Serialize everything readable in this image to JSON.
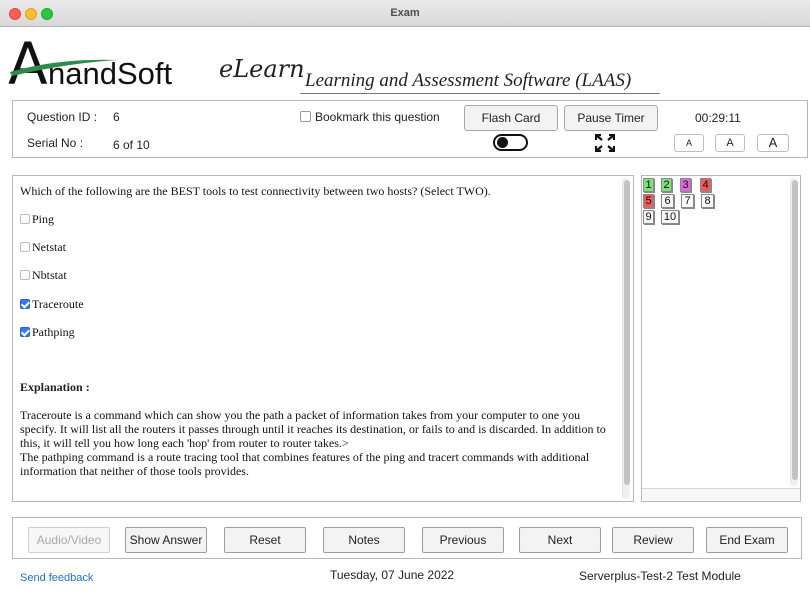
{
  "window": {
    "title": "Exam"
  },
  "brand": {
    "logo": "AnandSoft",
    "elearn": "eLearn",
    "tagline": "Learning and Assessment Software (LAAS)"
  },
  "header": {
    "question_id_label": "Question ID :",
    "question_id": "6",
    "serial_label": "Serial No :",
    "serial": "6 of 10",
    "bookmark_label": "Bookmark this question",
    "bookmark_checked": false,
    "flash_card": "Flash Card",
    "pause_timer": "Pause Timer",
    "timer": "00:29:11",
    "font_small": "A",
    "font_medium": "A",
    "font_large": "A"
  },
  "question": {
    "text": "Which of the following are the BEST tools to test connectivity between two hosts? (Select TWO).",
    "options": [
      {
        "label": "Ping",
        "checked": false
      },
      {
        "label": "Netstat",
        "checked": false
      },
      {
        "label": "Nbtstat",
        "checked": false
      },
      {
        "label": "Traceroute",
        "checked": true
      },
      {
        "label": "Pathping",
        "checked": true
      }
    ],
    "explanation_heading": "Explanation :",
    "explanation_1": "Traceroute is a command which can show you the path a packet of information takes from your computer to one you specify. It will list all the routers it passes through until it reaches its destination, or fails to and is discarded. In addition to this, it will tell you how long each 'hop' from router to router takes.>",
    "explanation_2": "The pathping command is a route tracing tool that combines features of the ping and tracert commands with additional information that neither of those tools provides."
  },
  "navigator": {
    "questions": [
      {
        "num": "1",
        "status": "green"
      },
      {
        "num": "2",
        "status": "green"
      },
      {
        "num": "3",
        "status": "magenta"
      },
      {
        "num": "4",
        "status": "red"
      },
      {
        "num": "5",
        "status": "red"
      },
      {
        "num": "6",
        "status": "none"
      },
      {
        "num": "7",
        "status": "none"
      },
      {
        "num": "8",
        "status": "none"
      },
      {
        "num": "9",
        "status": "none"
      },
      {
        "num": "10",
        "status": "none"
      }
    ]
  },
  "footer": {
    "audio_video": "Audio/Video",
    "show_answer": "Show Answer",
    "reset": "Reset",
    "notes": "Notes",
    "previous": "Previous",
    "next": "Next",
    "review": "Review",
    "end_exam": "End Exam"
  },
  "status": {
    "feedback": "Send feedback",
    "date": "Tuesday, 07 June 2022",
    "module": "Serverplus-Test-2 Test Module"
  },
  "colors": {
    "accent": "#3478f6",
    "answered": "#7ce07c",
    "marked": "#e266e2",
    "wrong": "#f25a5a",
    "link": "#1f6fd6"
  }
}
